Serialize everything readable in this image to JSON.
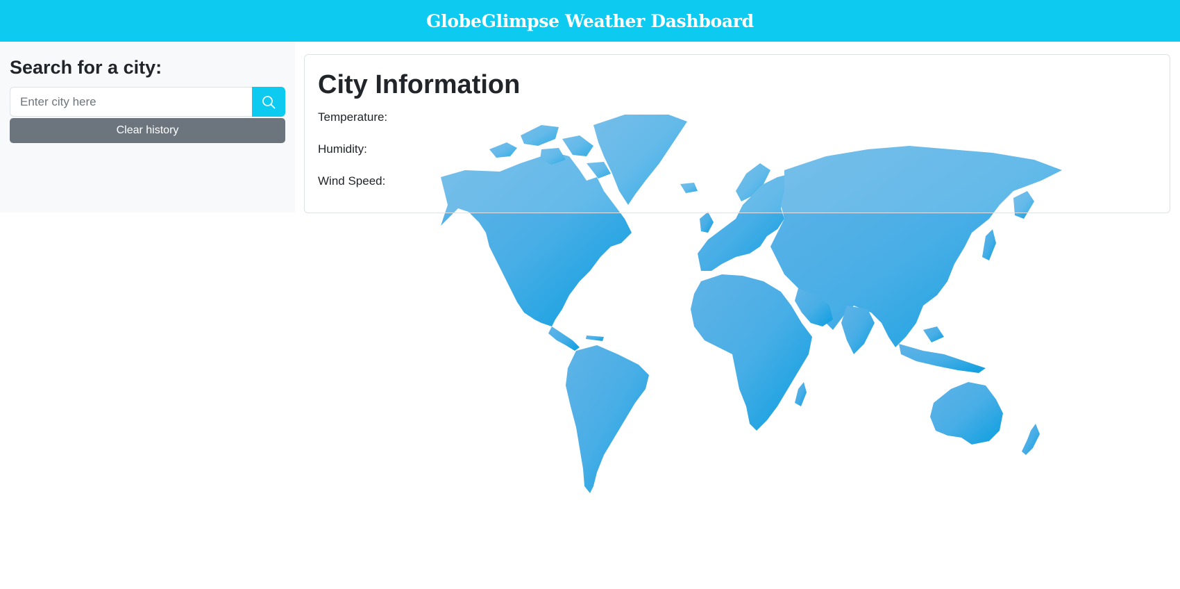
{
  "header": {
    "title": "GlobeGlimpse Weather Dashboard",
    "background_color": "#0dcaf0"
  },
  "sidebar": {
    "heading": "Search for a city:",
    "search": {
      "placeholder": "Enter city here",
      "value": "",
      "button_icon": "search-icon"
    },
    "clear_button_label": "Clear history",
    "clear_button_color": "#6c757d"
  },
  "city_info": {
    "title": "City Information",
    "temperature_label": "Temperature:",
    "temperature_value": "",
    "humidity_label": "Humidity:",
    "humidity_value": "",
    "wind_label": "Wind Speed:",
    "wind_value": ""
  },
  "background": {
    "image": "world-map-illustration",
    "color": "#3aa9e4"
  }
}
